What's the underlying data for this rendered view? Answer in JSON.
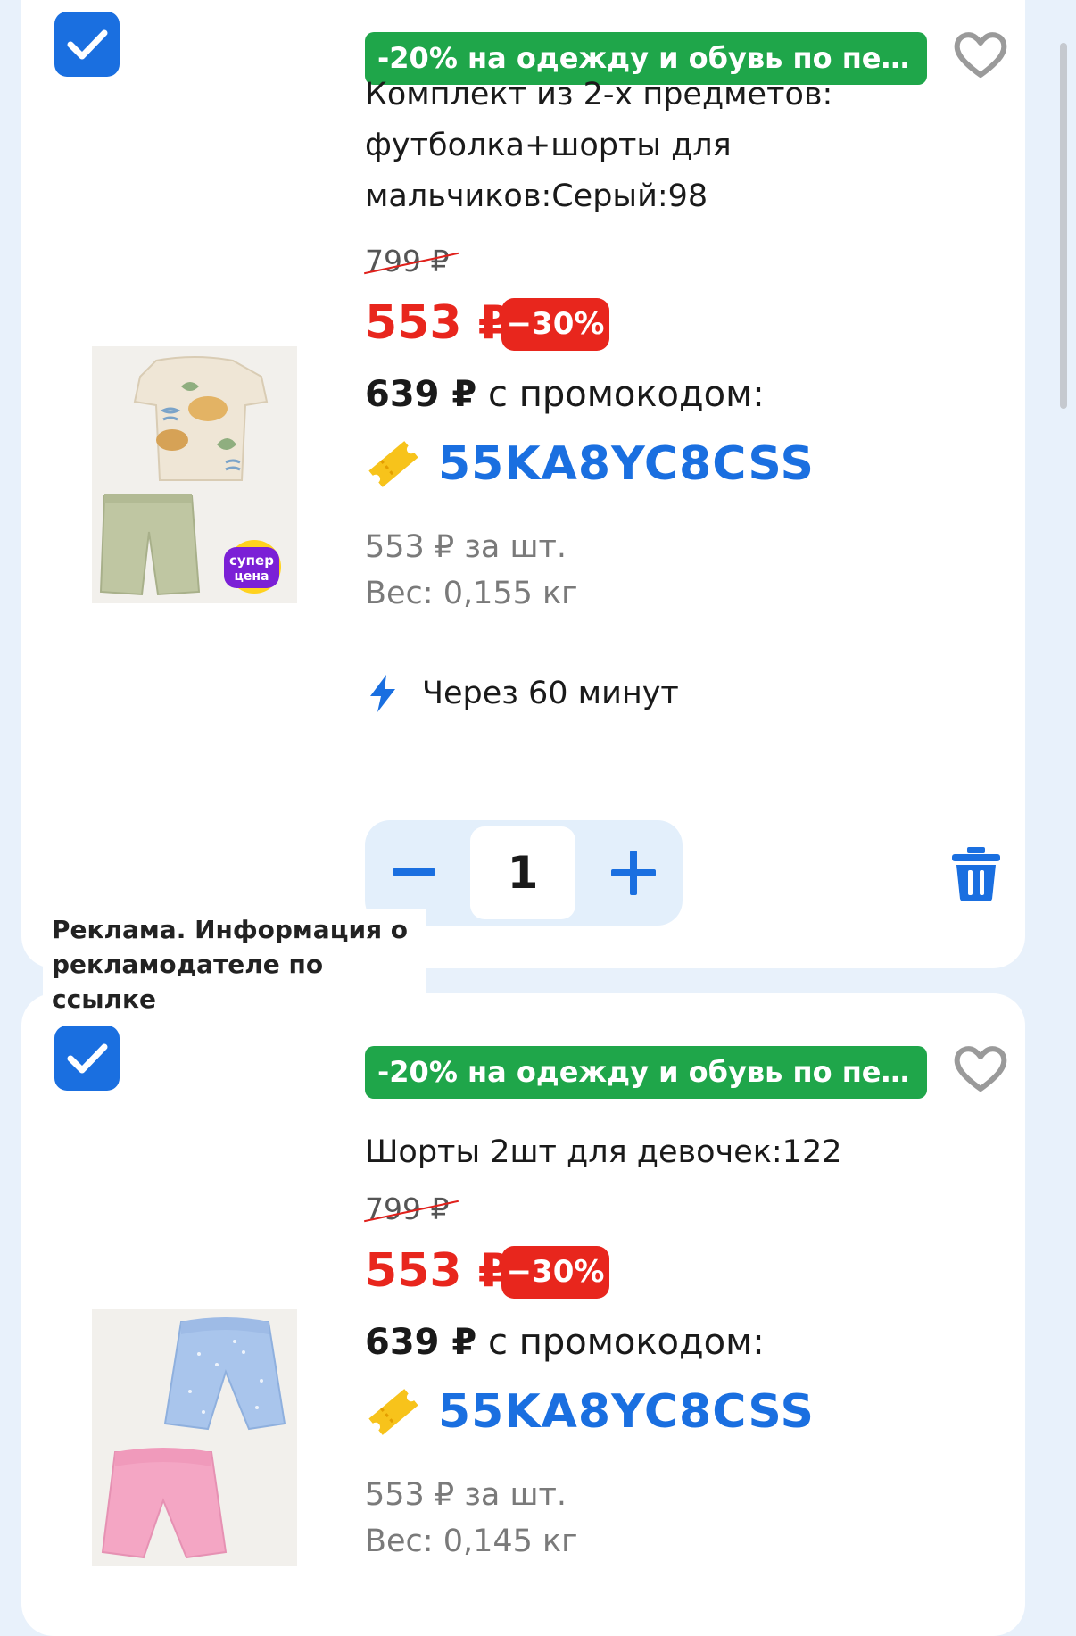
{
  "colors": {
    "accent": "#1a6fe0",
    "promo_green": "#1fa64a",
    "sale_red": "#e8261d",
    "background": "#e8f1fb"
  },
  "items": [
    {
      "checked": true,
      "promo_banner": "-20% на одежду и обувь по пе…",
      "title": "Комплект из 2-х предметов: футболка+шорты для мальчиков:Серый:98",
      "old_price": "799 ₽",
      "price": "553 ₽",
      "discount": "−30%",
      "promo_price": "639 ₽",
      "promo_price_suffix": " с промокодом:",
      "promo_code": "55KA8YC8CSS",
      "unit_price": "553 ₽ за шт.",
      "weight": "Вес: 0,155 кг",
      "delivery": "Через 60 минут",
      "quantity": "1",
      "image_badge": [
        "супер",
        "цена"
      ],
      "icons": [
        "checkbox-checked-icon",
        "heart-icon",
        "ticket-icon",
        "lightning-icon",
        "minus-icon",
        "plus-icon",
        "trash-icon"
      ]
    },
    {
      "checked": true,
      "promo_banner": "-20% на одежду и обувь по пе…",
      "title": "Шорты 2шт для девочек:122",
      "old_price": "799 ₽",
      "price": "553 ₽",
      "discount": "−30%",
      "promo_price": "639 ₽",
      "promo_price_suffix": " с промокодом:",
      "promo_code": "55KA8YC8CSS",
      "unit_price": "553 ₽ за шт.",
      "weight": "Вес: 0,145 кг"
    }
  ],
  "ad_label": "Реклама. Информация о рекламодателе по ссылке"
}
